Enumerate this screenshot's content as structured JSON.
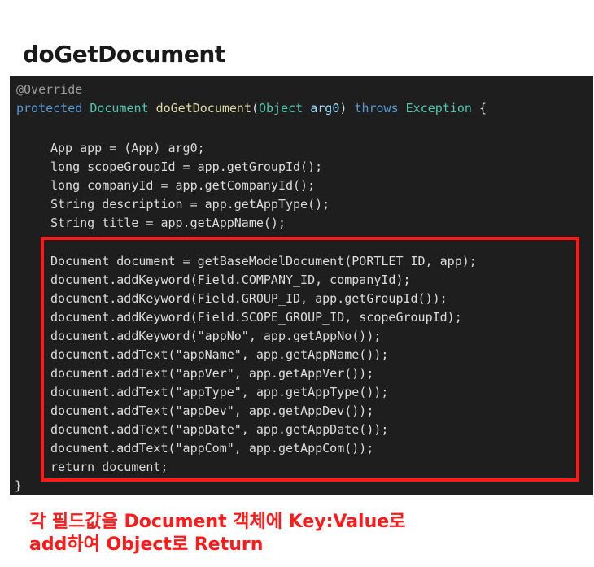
{
  "title": "doGetDocument",
  "code": {
    "annotation": "@Override",
    "signature": {
      "kw": "protected",
      "type": "Document",
      "name": "doGetDocument",
      "open": "(",
      "ptype": "Object",
      "param": "arg0",
      "close": ")",
      "throws": "throws",
      "ex": "Exception",
      "brace": "{"
    },
    "lines_before": [
      "App app = (App) arg0;",
      "long scopeGroupId = app.getGroupId();",
      "long companyId = app.getCompanyId();",
      "String description = app.getAppType();",
      "String title = app.getAppName();"
    ],
    "lines_box": [
      "Document document = getBaseModelDocument(PORTLET_ID, app);",
      "document.addKeyword(Field.COMPANY_ID, companyId);",
      "document.addKeyword(Field.GROUP_ID, app.getGroupId());",
      "document.addKeyword(Field.SCOPE_GROUP_ID, scopeGroupId);",
      "document.addKeyword(\"appNo\", app.getAppNo());",
      "document.addText(\"appName\", app.getAppName());",
      "document.addText(\"appVer\", app.getAppVer());",
      "document.addText(\"appType\", app.getAppType());",
      "document.addText(\"appDev\", app.getAppDev());",
      "document.addText(\"appDate\", app.getAppDate());",
      "document.addText(\"appCom\", app.getAppCom());",
      "return document;"
    ],
    "closing_brace": "}"
  },
  "caption": {
    "line1": "각 필드값을 Document 객체에 Key:Value로",
    "line2": "add하여 Object로 Return"
  },
  "colors": {
    "highlight_box": "#ff1a1a",
    "editor_bg": "#1e1e1e"
  }
}
